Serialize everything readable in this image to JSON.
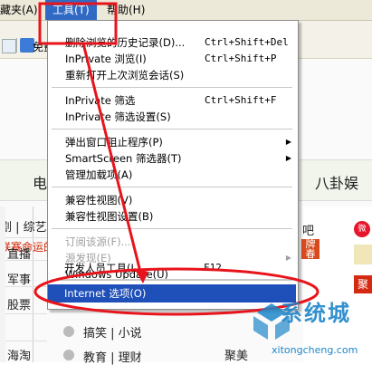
{
  "menubar": {
    "favorites": "藏夹(A)",
    "tools": "工具(T)",
    "help": "帮助(H)"
  },
  "toolbar": {
    "free_text": "免费"
  },
  "tools_menu": {
    "items": [
      {
        "label": "删除浏览的历史记录(D)...",
        "shortcut": "Ctrl+Shift+Del"
      },
      {
        "label": "InPrivate 浏览(I)",
        "shortcut": "Ctrl+Shift+P"
      },
      {
        "label": "重新打开上次浏览会话(S)",
        "shortcut": ""
      },
      {
        "label": "InPrivate 筛选",
        "shortcut": "Ctrl+Shift+F"
      },
      {
        "label": "InPrivate 筛选设置(S)",
        "shortcut": ""
      },
      {
        "label": "弹出窗口阻止程序(P)",
        "shortcut": ""
      },
      {
        "label": "SmartScreen 筛选器(T)",
        "shortcut": ""
      },
      {
        "label": "管理加载项(A)",
        "shortcut": ""
      },
      {
        "label": "兼容性视图(V)",
        "shortcut": ""
      },
      {
        "label": "兼容性视图设置(B)",
        "shortcut": ""
      },
      {
        "label": "订阅该源(F)...",
        "shortcut": ""
      },
      {
        "label": "源发现(E)",
        "shortcut": ""
      },
      {
        "label": "Windows Update(U)",
        "shortcut": ""
      },
      {
        "label": "开发人员工具(L)",
        "shortcut": "F12"
      },
      {
        "label": "Internet 选项(O)",
        "shortcut": ""
      }
    ]
  },
  "page": {
    "nav_left": "电",
    "nav_right": "八卦娱",
    "side": {
      "s1": "剧 | 综艺",
      "s2": "联赛命运的",
      "s3": "直播",
      "s4": "军事",
      "s5": "股票",
      "s6": "海淘"
    },
    "bottom": {
      "b1": "搞笑 | 小说",
      "b2": "教育 | 理财",
      "b3": "聚美"
    },
    "right": {
      "r1": "吧",
      "r2": "牌",
      "r3": "春",
      "weibo": "微",
      "red_box": "聚"
    }
  },
  "watermark": {
    "brand": "系统城",
    "url": "xitongcheng.com"
  },
  "colors": {
    "highlight": "#1f4fb8",
    "annotation": "#e8141b",
    "watermark": "#1f86c8"
  }
}
